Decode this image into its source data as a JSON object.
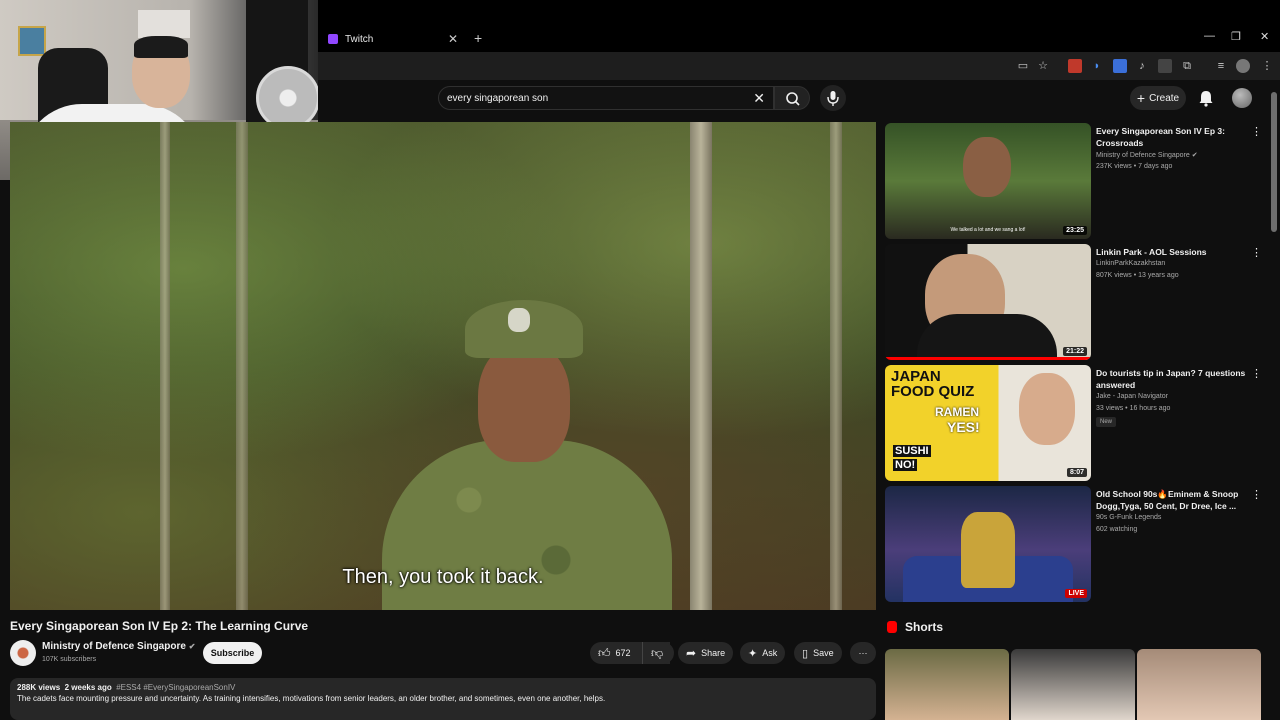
{
  "browser": {
    "tab_title": "Twitch",
    "tab_close": "✕",
    "new_tab": "+",
    "window_controls": [
      "—",
      "❐",
      "✕"
    ]
  },
  "search": {
    "query": "every singaporean son",
    "clear": "✕"
  },
  "header": {
    "create_label": "Create",
    "create_icon": "+"
  },
  "player": {
    "subtitle": "Then, you took it back."
  },
  "video": {
    "title": "Every Singaporean Son IV Ep 2: The Learning Curve",
    "channel": "Ministry of Defence Singapore",
    "subscribers": "107K subscribers",
    "subscribe_label": "Subscribe",
    "likes": "672",
    "share_label": "Share",
    "ask_label": "Ask",
    "save_label": "Save",
    "more": "···",
    "views": "288K views",
    "age": "2 weeks ago",
    "tags": "#ESS4 #EverySingaporeanSonIV",
    "description": "The cadets face mounting pressure and uncertainty. As training intensifies, motivations from senior leaders, an older brother, and sometimes, even one another, helps."
  },
  "recommendations": [
    {
      "title": "Every Singaporean Son IV Ep 3: Crossroads",
      "channel": "Ministry of Defence Singapore ✔",
      "meta": "237K views • 7 days ago",
      "duration": "23:25",
      "thumb_caption": "We talked a lot and we sang a lot!"
    },
    {
      "title": "Linkin Park - AOL Sessions",
      "channel": "LinkinParkKazakhstan",
      "meta": "807K views • 13 years ago",
      "duration": "21:22",
      "progress": 1.0
    },
    {
      "title": "Do tourists tip in Japan? 7 questions answered",
      "channel": "Jake - Japan Navigator",
      "meta": "33 views • 16 hours ago",
      "badge": "New",
      "duration": "8:07",
      "thumb_text": [
        "JAPAN",
        "FOOD QUIZ",
        "RAMEN",
        "YES!",
        "SUSHI",
        "NO!"
      ]
    },
    {
      "title": "Old School 90s🔥Eminem & Snoop Dogg,Tyga, 50 Cent, Dr Dree, Ice ...",
      "channel": "90s G-Funk Legends",
      "meta": "602 watching",
      "live": "LIVE"
    }
  ],
  "shorts": {
    "heading": "Shorts"
  },
  "colors": {
    "background": "#0f0f0f",
    "accent_red": "#ff0000",
    "pill_bg": "#272727"
  }
}
